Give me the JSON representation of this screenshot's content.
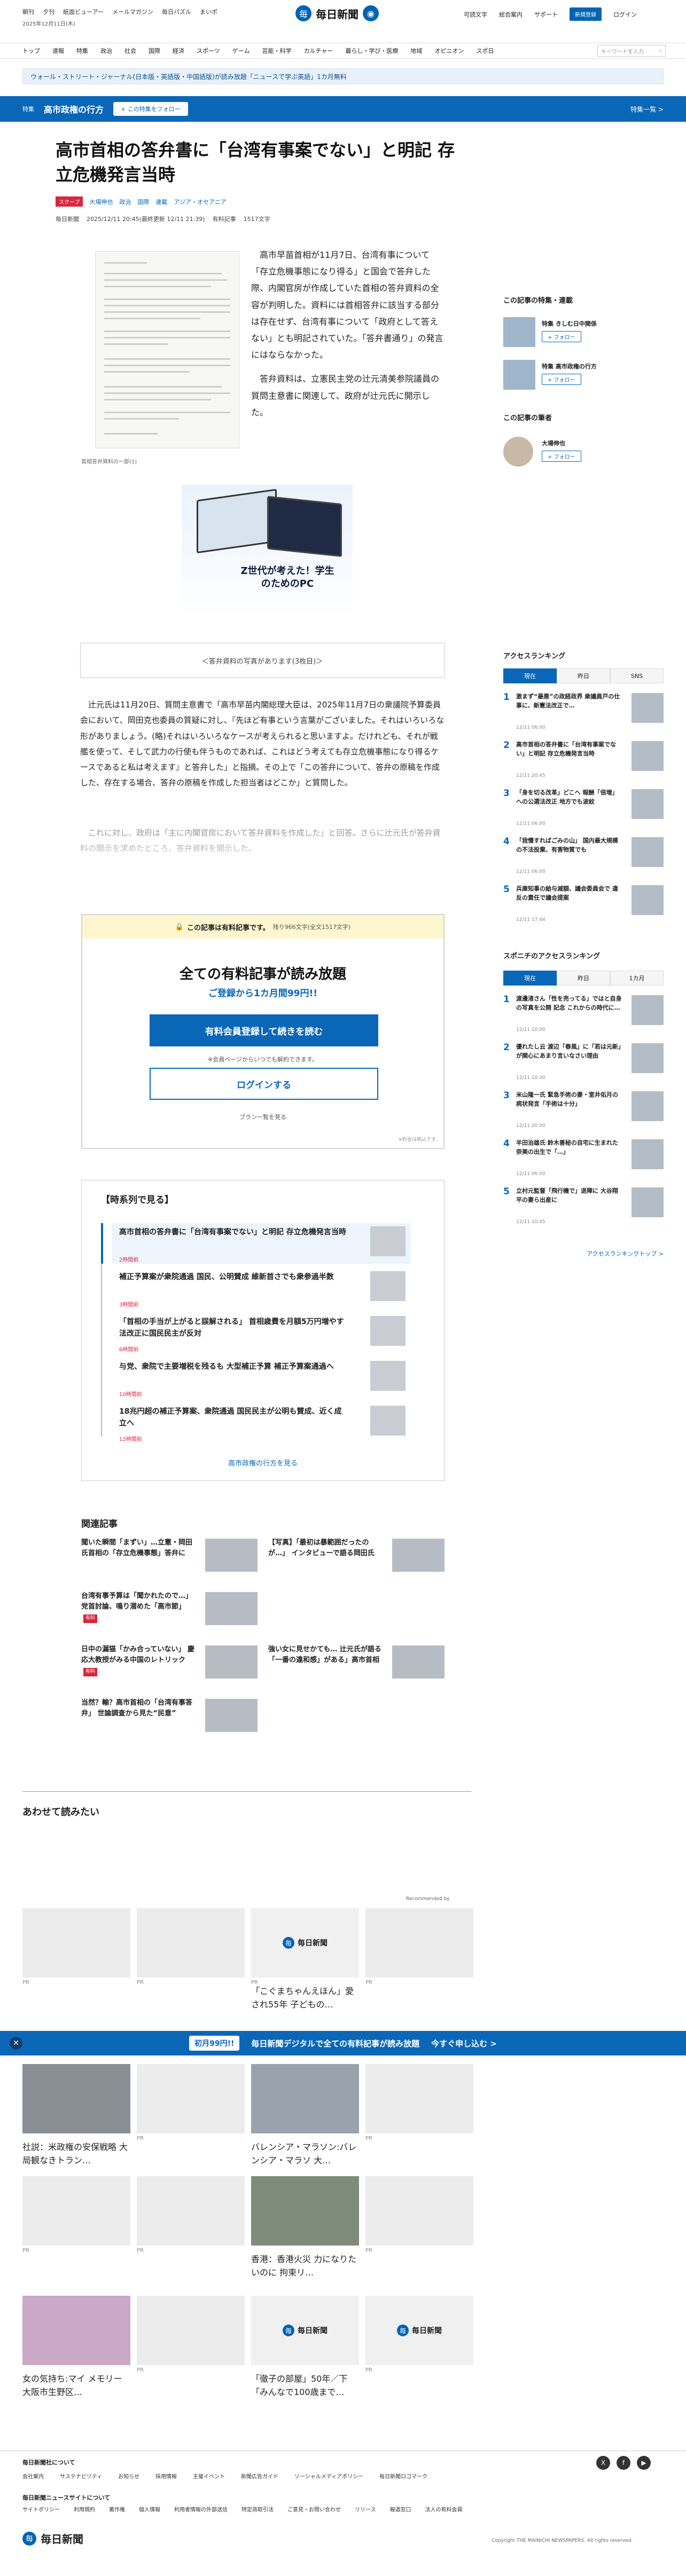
{
  "header": {
    "top_links": [
      "朝刊",
      "夕刊",
      "紙面ビューアー",
      "メールマガジン",
      "毎日パズル",
      "まいポ"
    ],
    "date": "2025年12月11日(木)",
    "logo_mark": "毎",
    "logo_name": "毎日新聞",
    "right_links": [
      "可読文字",
      "総合案内",
      "サポート"
    ],
    "register_label": "新規登録",
    "login_label": "ログイン"
  },
  "nav": {
    "items": [
      "トップ",
      "速報",
      "特集",
      "政治",
      "社会",
      "国際",
      "経済",
      "スポーツ",
      "ゲーム",
      "芸能・科学",
      "カルチャー",
      "暮らし・学び・医療",
      "地域",
      "オピニオン",
      "スポ日"
    ],
    "search_placeholder": "キーワードを入力"
  },
  "notice": "ウォール・ストリート・ジャーナル(日本版・英語版・中国語版)が読み放題「ニュースで学ぶ英語」1カ月無料",
  "feature": {
    "tag": "特集",
    "title": "高市政権の行方",
    "follow": "+ この特集をフォロー",
    "list_link": "特集一覧 >"
  },
  "article": {
    "title": "高市首相の答弁書に「台湾有事案でない」と明記 存立危機発言当時",
    "tag_red": "スクープ",
    "tags": [
      "大場伸也",
      "政治",
      "国際",
      "連載",
      "アジア・オセアニア"
    ],
    "meta": [
      "毎日新聞",
      "2025/12/11 20:45(最終更新 12/11 21:39)",
      "有料記事",
      "1517文字"
    ],
    "doc_caption": "首相答弁資料の一部(1)",
    "lead": "高市早苗首相が11月7日、台湾有事について「存立危機事態になり得る」と国会で答弁した際、内閣官房が作成していた首相の答弁資料の全容が判明した。資料には首相答弁に該当する部分は存在せず、台湾有事について「政府として答えない」とも明記されていた。「答弁書通り」の発言にはならなかった。",
    "lead2": "答弁資料は、立憲民主党の辻元清美参院議員の質問主意書に関連して、政府が辻元氏に開示した。",
    "ad_copy": "Z世代が考えた！学生のためのPC",
    "more_photos": "＜答弁資料の写真があります(3枚目)＞",
    "body": "辻元氏は11月20日、質問主意書で「高市早苗内閣総理大臣は、2025年11月7日の衆議院予算委員会において、岡田克也委員の質疑に対し、『先ほど有事という言葉がございました。それはいろいろな形がありましょう。(略)それはいろいろなケースが考えられると思いますよ。だけれども、それが戦艦を使って、そして武力の行使も伴うものであれば、これはどう考えても存立危機事態になり得るケースであると私は考えます』と答弁した」と指摘。その上で「この答弁について、答弁の原稿を作成した、存在する場合、答弁の原稿を作成した担当者はどこか」と質問した。",
    "fade": "これに対し、政府は「主に内閣官房において答弁資料を作成した」と回答。さらに辻元氏が答弁資料の開示を求めたところ、答弁資料を開示した。"
  },
  "paywall": {
    "head": "この記事は有料記事です。",
    "remaining": "残り966文字(全文1517文字)",
    "title": "全ての有料記事が読み放題",
    "sub": "ご登録から1カ月間99円!!",
    "register_btn": "有料会員登録して続きを読む",
    "note": "※会員ページからいつでも解約できます。",
    "login_btn": "ログインする",
    "plan": "プラン一覧を見る",
    "small": "※料金は税込です"
  },
  "timeline": {
    "title": "【時系列で見る】",
    "items": [
      {
        "text": "高市首相の答弁書に「台湾有事案でない」と明記 存立危機発言当時",
        "date": "2時間前"
      },
      {
        "text": "補正予算案が衆院通過 国民、公明賛成 維新首さでも衆参過半数",
        "date": "3時間前"
      },
      {
        "text": "「首相の手当が上がると誤解される」 首相歳費を月額5万円増やす法改正に国民民主が反対",
        "date": "6時間前"
      },
      {
        "text": "与党、衆院で主要増税を残るも 大型補正予算 補正予算案通過へ",
        "date": "10時間前"
      },
      {
        "text": "18兆円超の補正予算案、衆院通過 国民民主が公明も賛成、近く成立へ",
        "date": "12時間前"
      }
    ],
    "footer": "高市政権の行方を見る"
  },
  "related": {
    "title": "関連記事",
    "items": [
      {
        "text": "聞いた瞬間「まずい」…立憲・岡田氏首相の「存立危機事態」答弁に",
        "badge": ""
      },
      {
        "text": "【写真】「最初は暴範囲だったのが…」 インタビューで語る岡田氏",
        "badge": ""
      },
      {
        "text": "台湾有事予算は「聞かれたので…」 党首討論、鳴り潜めた「高市節」",
        "badge": "有料"
      },
      {
        "text": "",
        "badge": ""
      },
      {
        "text": "日中の漏猫「かみ合っていない」 慶応大教授がみる中国のレトリック",
        "badge": "有料"
      },
      {
        "text": "強い女に見せかても… 辻元氏が語る「一番の違和感」がある」高市首相",
        "badge": ""
      },
      {
        "text": "当然？輸？高市首相の「台湾有事答弁」 世論調査から見た“民意”",
        "badge": ""
      }
    ]
  },
  "recommend": {
    "title": "あわせて読みたい",
    "by": "Recommended by",
    "cards": [
      {
        "caption": "",
        "pr": "PR"
      },
      {
        "caption": "",
        "pr": "PR"
      },
      {
        "caption": "",
        "pr": "PR"
      },
      {
        "caption": "「こぐまちゃんえほん」愛され55年 子どもの…",
        "pr": ""
      },
      {
        "caption": "",
        "pr": "PR"
      }
    ],
    "cards2": [
      {
        "caption": "社説：米政権の安保戦略 大局観なきトラン…",
        "pr": ""
      },
      {
        "caption": "",
        "pr": "PR"
      },
      {
        "caption": "バレンシア・マラソン:バレンシア・マラソ 大…",
        "pr": ""
      },
      {
        "caption": "",
        "pr": "PR"
      }
    ],
    "cards3": [
      {
        "caption": "",
        "pr": "PR"
      },
      {
        "caption": "",
        "pr": "PR"
      },
      {
        "caption": "香港：香港火災 力になりたいのに 拘束リ…",
        "pr": ""
      },
      {
        "caption": "",
        "pr": "PR"
      }
    ],
    "cards4": [
      {
        "caption": "女の気持ち:マイ メモリー 大阪市生野区…",
        "pr": ""
      },
      {
        "caption": "",
        "pr": "PR"
      },
      {
        "caption": "「徹子の部屋」50年／下 「みんなで100歳まで…",
        "pr": ""
      },
      {
        "caption": "",
        "pr": "PR"
      }
    ]
  },
  "promo": {
    "badge": "初月99円!!",
    "text": "毎日新聞デジタルで全ての有料記事が読み放題",
    "link": "今すぐ申し込む >"
  },
  "sidebar": {
    "feature_title": "この記事の特集・連載",
    "features": [
      {
        "name": "特集 きしむ日中関係"
      },
      {
        "name": "特集 高市政権の行方"
      }
    ],
    "follow": "+ フォロー",
    "author_title": "この記事の筆者",
    "author": "大場伸也",
    "access_title": "アクセスランキング",
    "tabs": [
      "現在",
      "昨日",
      "SNS"
    ],
    "ranks": [
      {
        "no": "1",
        "text": "激まず“最悪”の政経政界 衆議員戸の仕事に、新憲法改正で…",
        "time": "12/11 06:00"
      },
      {
        "no": "2",
        "text": "高市首相の答弁書に「台湾有事案でない」と明記 存立危機発言当時",
        "time": "12/11 20:45"
      },
      {
        "no": "3",
        "text": "「身を切る改革」どこへ 報酬「倍増」への公選法改正 地方でも波紋",
        "time": "12/11 06:00"
      },
      {
        "no": "4",
        "text": "「我慢すればごみの山」 国内最大規模の不法投棄、有害物質でも",
        "time": "12/11 06:00"
      },
      {
        "no": "5",
        "text": "兵庫知事の給与減額、議会委員会で 違反の責任で議会提案",
        "time": "12/11 17:44"
      }
    ],
    "sponichi_title": "スポニチのアクセスランキング",
    "sp_tabs": [
      "現在",
      "昨日",
      "1カ月"
    ],
    "sp_ranks": [
      {
        "no": "1",
        "text": "渡邊渚さん「性を売ってる」ではと自身の写真を公開 記念 これからの時代に…",
        "time": "12/11 10:00"
      },
      {
        "no": "2",
        "text": "優れたし云 渡辺「春風」に「若は元新」が関心にあまり言いなさい理由",
        "time": "12/11 10:30"
      },
      {
        "no": "3",
        "text": "米山隆一氏 緊急手術の妻・室井佑月の病状発言「手術は十分」",
        "time": "12/11 20:00"
      },
      {
        "no": "4",
        "text": "半田治雄氏 鈴木善秘の自宅に生まれた奈美の出生で「…」",
        "time": "12/11 06:00"
      },
      {
        "no": "5",
        "text": "立村元監督「飛行機で」退陣に 大谷翔平の妻ら出産に",
        "time": "12/11 10:45"
      }
    ],
    "access_more": "アクセスランキングトップ >"
  },
  "footer": {
    "row1": "毎日新聞社について",
    "links1": [
      "会社案内",
      "サステナビリティ",
      "お知らせ",
      "採用情報",
      "主催イベント",
      "新聞広告ガイド",
      "ソーシャルメディアポリシー",
      "毎日新聞ロゴマーク"
    ],
    "row2": "毎日新聞ニュースサイトについて",
    "links2": [
      "サイトポリシー",
      "利用規約",
      "著作権",
      "個人情報",
      "利用者情報の外部送信",
      "特定商取引法",
      "ご意見・お問い合わせ",
      "リリース",
      "報道窓口",
      "法人の有料会員"
    ],
    "social": [
      "X",
      "f",
      "▶"
    ],
    "copyright": "Copyright THE MAINICHI NEWSPAPERS. All rights reserved."
  },
  "colors": {
    "brand": "#0a67b8",
    "accent_red": "#d7263d"
  }
}
